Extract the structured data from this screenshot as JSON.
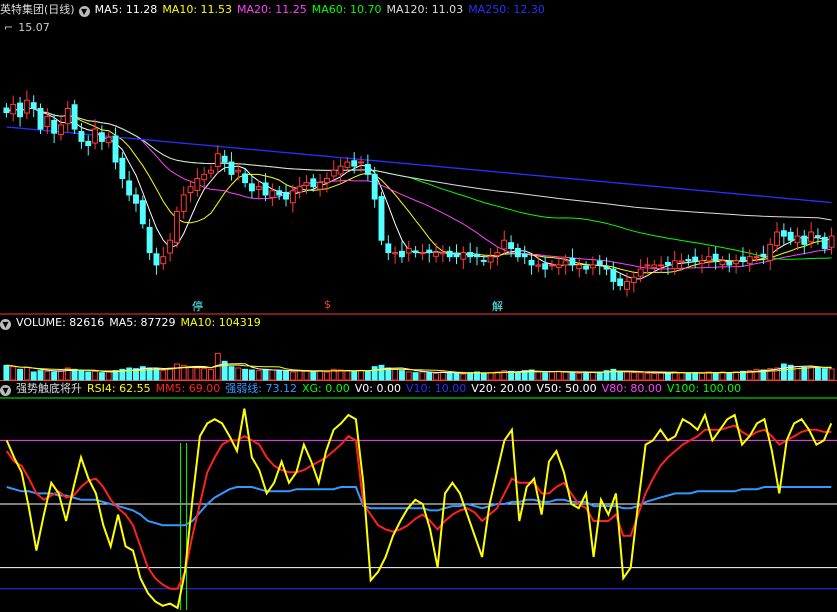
{
  "colors": {
    "up": "#ff3a3a",
    "down": "#54ffff",
    "ma5": "#ffffff",
    "ma10": "#ffff00",
    "ma20": "#ff40ff",
    "ma60": "#00ff00",
    "ma120": "#dddddd",
    "ma250": "#2233ff",
    "rsi4": "#ffff00",
    "mm5": "#ff2020",
    "strength": "#3399ff",
    "divider": "#ff3333"
  },
  "price_panel": {
    "title": "英特集团(日线)",
    "price_label": "15.07",
    "indicators": [
      {
        "name": "MA5",
        "value": "11.28",
        "color": "#ffffff"
      },
      {
        "name": "MA10",
        "value": "11.53",
        "color": "#ffff00"
      },
      {
        "name": "MA20",
        "value": "11.25",
        "color": "#ff40ff"
      },
      {
        "name": "MA60",
        "value": "10.70",
        "color": "#00ff00"
      },
      {
        "name": "MA120",
        "value": "11.03",
        "color": "#dddddd"
      },
      {
        "name": "MA250",
        "value": "12.30",
        "color": "#2233ff"
      }
    ],
    "markers": [
      {
        "label": "停",
        "color": "#54ffff"
      },
      {
        "label": "$",
        "color": "#ff3a3a"
      },
      {
        "label": "解",
        "color": "#54ffff"
      }
    ]
  },
  "volume_panel": {
    "title": "VOLUME",
    "indicators": [
      {
        "name": "VOLUME",
        "value": "82616",
        "color": "#ffffff"
      },
      {
        "name": "MA5",
        "value": "87729",
        "color": "#ffffff"
      },
      {
        "name": "MA10",
        "value": "104319",
        "color": "#ffff00"
      }
    ]
  },
  "indicator_panel": {
    "title": "强势触底将升",
    "indicators": [
      {
        "name": "RSI4",
        "value": "62.55",
        "color": "#ffff00"
      },
      {
        "name": "MM5",
        "value": "69.00",
        "color": "#ff2020"
      },
      {
        "name": "强弱线",
        "value": "73.12",
        "color": "#3399ff"
      },
      {
        "name": "XG",
        "value": "0.00",
        "color": "#00ff00"
      },
      {
        "name": "V0",
        "value": "0.00",
        "color": "#ffffff"
      },
      {
        "name": "V10",
        "value": "10.00",
        "color": "#2233ff"
      },
      {
        "name": "V20",
        "value": "20.00",
        "color": "#ffffff"
      },
      {
        "name": "V50",
        "value": "50.00",
        "color": "#ffffff"
      },
      {
        "name": "V80",
        "value": "80.00",
        "color": "#ff40ff"
      },
      {
        "name": "V100",
        "value": "100.00",
        "color": "#00ff00"
      }
    ]
  },
  "chart_data": {
    "type": "candlestick",
    "price_range": [
      8.7,
      15.5
    ],
    "volume_range": [
      0,
      300000
    ],
    "indicator_range": [
      0,
      100
    ],
    "reference_lines": [
      {
        "name": "V100",
        "value": 100,
        "color": "#00ff00"
      },
      {
        "name": "V80",
        "value": 80,
        "color": "#ff40ff"
      },
      {
        "name": "V50",
        "value": 50,
        "color": "#ffffff"
      },
      {
        "name": "V20",
        "value": 20,
        "color": "#ffffff"
      },
      {
        "name": "V10",
        "value": 10,
        "color": "#2233ff"
      }
    ],
    "closes": [
      13.3,
      13.5,
      13.2,
      13.6,
      13.4,
      12.9,
      13.2,
      12.8,
      13.0,
      13.4,
      12.9,
      12.6,
      12.5,
      12.9,
      12.6,
      12.7,
      12.1,
      11.7,
      11.3,
      11.1,
      10.6,
      9.9,
      9.6,
      9.8,
      10.2,
      10.9,
      11.3,
      11.5,
      11.7,
      11.8,
      11.9,
      12.3,
      12.1,
      11.8,
      11.9,
      11.6,
      11.4,
      11.5,
      11.3,
      11.4,
      11.3,
      11.2,
      11.4,
      11.5,
      11.6,
      11.5,
      11.6,
      11.7,
      11.9,
      12.0,
      12.1,
      12.0,
      12.1,
      11.8,
      11.2,
      10.2,
      9.9,
      9.9,
      9.8,
      10.0,
      9.9,
      9.9,
      9.9,
      9.9,
      9.9,
      9.8,
      9.8,
      9.9,
      9.8,
      9.8,
      9.7,
      9.8,
      9.9,
      10.2,
      10.0,
      9.8,
      9.8,
      9.6,
      9.6,
      9.5,
      9.6,
      9.6,
      9.7,
      9.6,
      9.6,
      9.5,
      9.6,
      9.6,
      9.5,
      9.2,
      9.1,
      9.2,
      9.3,
      9.5,
      9.6,
      9.6,
      9.6,
      9.6,
      9.7,
      9.7,
      9.7,
      9.7,
      9.7,
      9.8,
      9.7,
      9.7,
      9.6,
      9.7,
      9.7,
      9.8,
      9.8,
      9.8,
      10.1,
      10.4,
      10.3,
      10.2,
      10.3,
      10.1,
      10.4,
      10.3,
      10.0,
      10.3
    ],
    "volumes": [
      110000,
      100000,
      80000,
      95000,
      60000,
      70000,
      65000,
      60000,
      70000,
      90000,
      80000,
      70000,
      60000,
      65000,
      55000,
      60000,
      70000,
      80000,
      90000,
      85000,
      100000,
      90000,
      85000,
      70000,
      90000,
      120000,
      110000,
      100000,
      90000,
      85000,
      80000,
      200000,
      140000,
      100000,
      90000,
      80000,
      75000,
      70000,
      80000,
      75000,
      70000,
      65000,
      60000,
      70000,
      70000,
      65000,
      70000,
      60000,
      80000,
      75000,
      70000,
      65000,
      70000,
      65000,
      100000,
      110000,
      90000,
      80000,
      70000,
      60000,
      55000,
      60000,
      55000,
      50000,
      60000,
      55000,
      50000,
      45000,
      55000,
      60000,
      50000,
      55000,
      60000,
      70000,
      65000,
      60000,
      70000,
      75000,
      60000,
      55000,
      60000,
      65000,
      60000,
      55000,
      50000,
      55000,
      60000,
      60000,
      70000,
      80000,
      65000,
      60000,
      55000,
      55000,
      50000,
      50000,
      55000,
      50000,
      60000,
      55000,
      50000,
      55000,
      50000,
      60000,
      55000,
      60000,
      55000,
      60000,
      65000,
      70000,
      80000,
      75000,
      85000,
      90000,
      120000,
      110000,
      100000,
      95000,
      100000,
      90000,
      85000,
      82616
    ],
    "rsi4": [
      80,
      72,
      65,
      48,
      28,
      45,
      60,
      55,
      42,
      58,
      72,
      62,
      55,
      40,
      30,
      45,
      30,
      28,
      15,
      8,
      4,
      2,
      3,
      1,
      18,
      52,
      82,
      88,
      90,
      88,
      82,
      75,
      95,
      72,
      66,
      55,
      60,
      70,
      60,
      65,
      78,
      70,
      60,
      75,
      85,
      88,
      92,
      90,
      60,
      14,
      18,
      25,
      35,
      42,
      48,
      52,
      50,
      38,
      20,
      55,
      60,
      55,
      45,
      35,
      25,
      50,
      65,
      80,
      85,
      42,
      58,
      62,
      45,
      70,
      75,
      65,
      50,
      48,
      55,
      25,
      52,
      45,
      55,
      15,
      20,
      50,
      78,
      80,
      85,
      80,
      82,
      90,
      88,
      85,
      92,
      80,
      85,
      90,
      92,
      78,
      82,
      88,
      90,
      75,
      55,
      80,
      88,
      90,
      85,
      78,
      80,
      88
    ],
    "mm5": [
      75,
      70,
      68,
      62,
      55,
      52,
      54,
      56,
      53,
      54,
      58,
      61,
      62,
      58,
      52,
      48,
      45,
      40,
      30,
      20,
      15,
      12,
      10,
      10,
      18,
      35,
      50,
      65,
      72,
      78,
      80,
      80,
      82,
      80,
      78,
      72,
      68,
      66,
      65,
      65,
      66,
      68,
      70,
      72,
      75,
      78,
      82,
      80,
      50,
      45,
      40,
      38,
      37,
      38,
      40,
      43,
      45,
      42,
      38,
      42,
      45,
      47,
      48,
      46,
      42,
      45,
      48,
      55,
      62,
      60,
      60,
      60,
      55,
      55,
      58,
      60,
      55,
      50,
      48,
      42,
      42,
      42,
      45,
      35,
      35,
      45,
      55,
      62,
      68,
      72,
      75,
      78,
      80,
      82,
      85,
      85,
      85,
      86,
      87,
      84,
      82,
      84,
      85,
      82,
      78,
      80,
      82,
      84,
      85,
      85,
      84,
      84
    ],
    "strength": [
      58,
      57,
      56,
      56,
      55,
      55,
      55,
      54,
      54,
      53,
      52,
      52,
      52,
      51,
      50,
      49,
      48,
      47,
      45,
      42,
      41,
      40,
      40,
      40,
      40,
      42,
      46,
      50,
      53,
      55,
      57,
      58,
      58,
      58,
      57,
      56,
      56,
      56,
      56,
      57,
      57,
      57,
      57,
      57,
      57,
      58,
      58,
      58,
      49,
      48,
      48,
      48,
      48,
      48,
      48,
      48,
      48,
      47,
      47,
      48,
      49,
      49,
      50,
      49,
      48,
      49,
      50,
      50,
      51,
      51,
      52,
      52,
      51,
      51,
      52,
      52,
      51,
      51,
      51,
      49,
      49,
      49,
      49,
      48,
      48,
      49,
      51,
      52,
      53,
      54,
      55,
      55,
      55,
      56,
      56,
      56,
      56,
      56,
      56,
      57,
      57,
      57,
      58,
      58,
      58,
      58,
      58,
      58,
      58,
      58,
      58,
      58
    ]
  }
}
